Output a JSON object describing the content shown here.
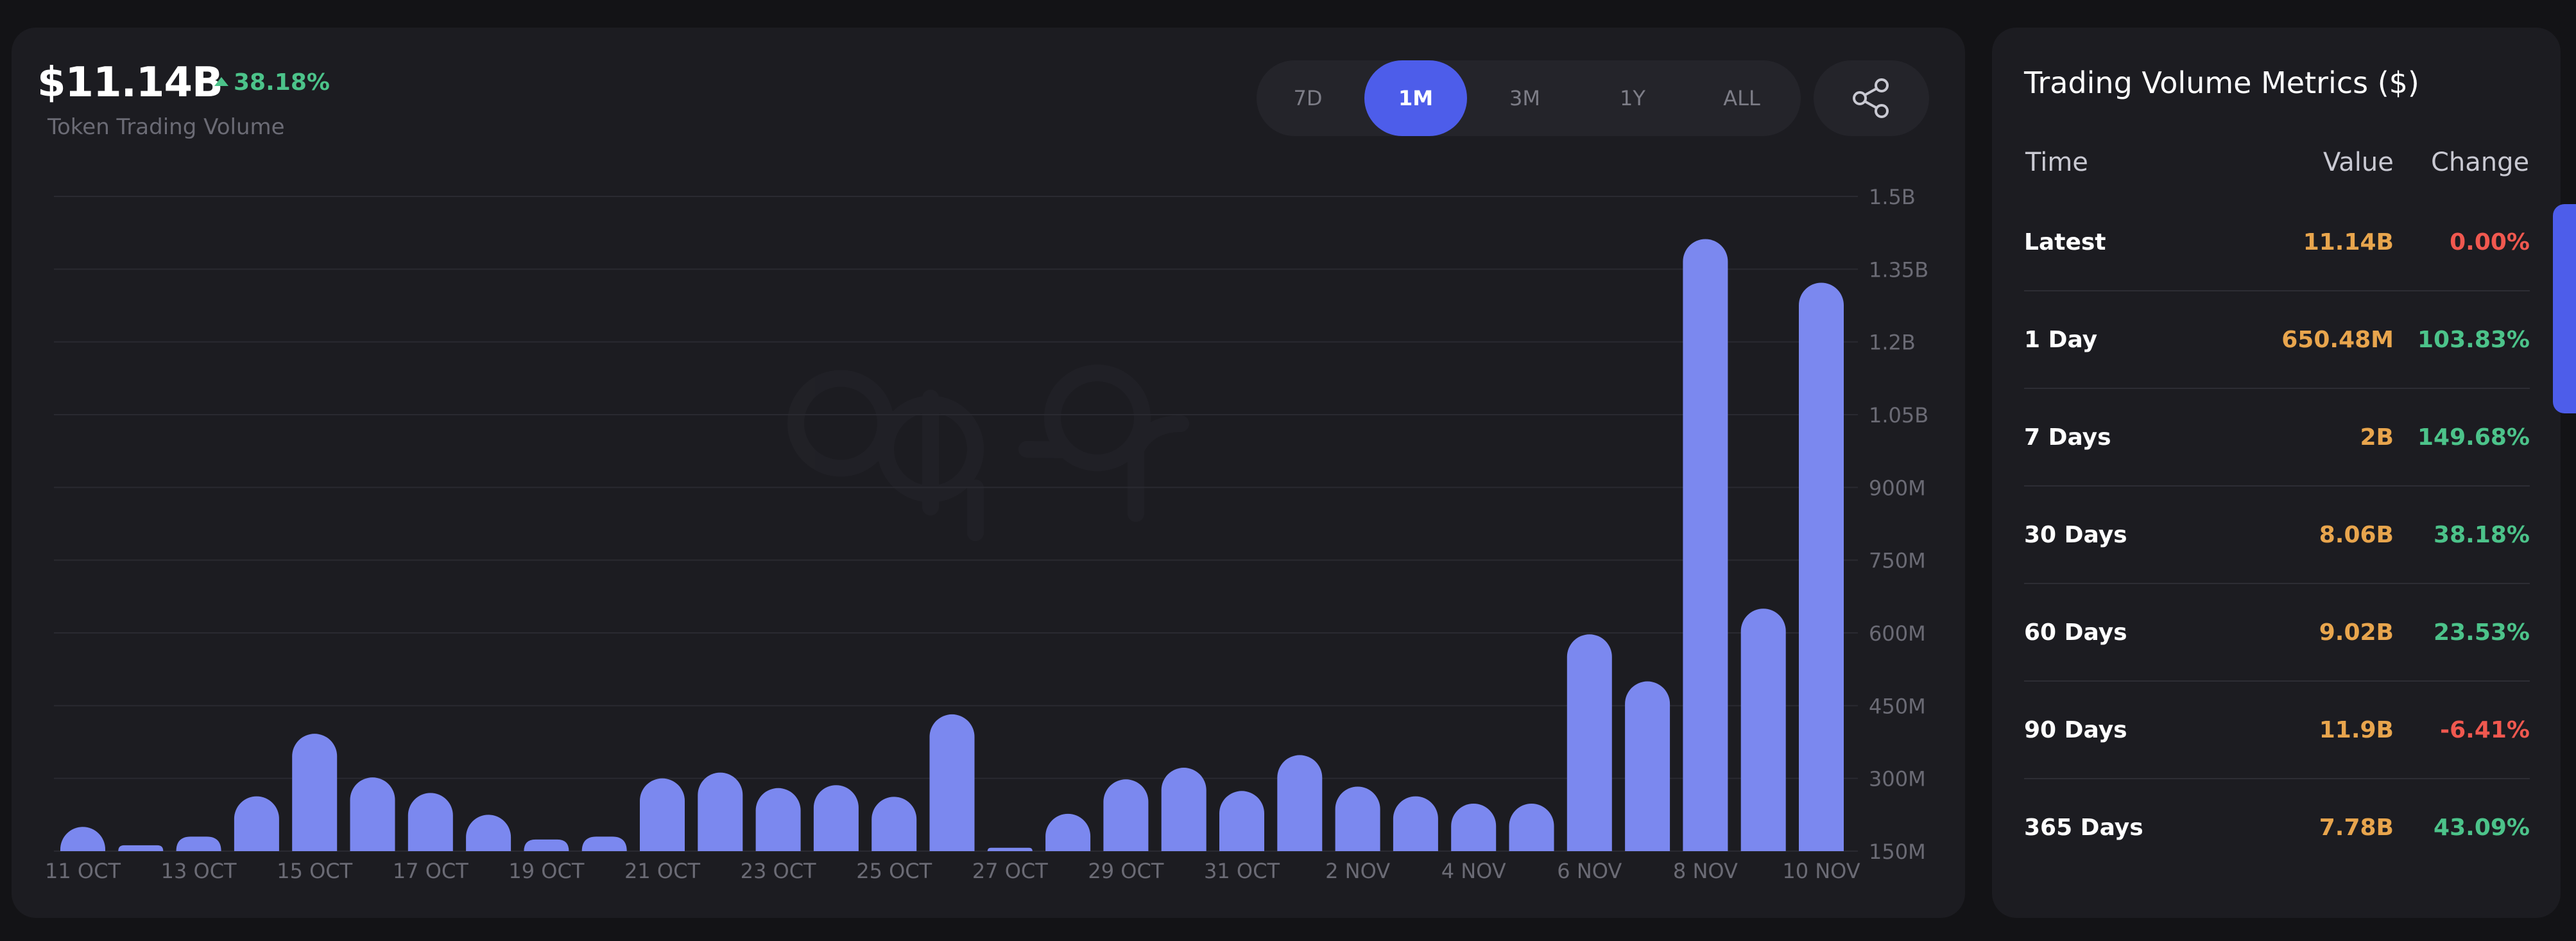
{
  "header": {
    "value": "$11.14B",
    "change": "38.18%",
    "subtitle": "Token Trading Volume"
  },
  "range_tabs": [
    "7D",
    "1M",
    "3M",
    "1Y",
    "ALL"
  ],
  "active_range": "1M",
  "colors": {
    "bar": "#7b88ef",
    "accent": "#4d5dea",
    "positive": "#4cc38a",
    "negative": "#f0584f",
    "value": "#e8a54d"
  },
  "metrics": {
    "title": "Trading Volume Metrics ($)",
    "columns": [
      "Time",
      "Value",
      "Change"
    ],
    "rows": [
      {
        "time": "Latest",
        "value": "11.14B",
        "change": "0.00%",
        "trend": "negative"
      },
      {
        "time": "1 Day",
        "value": "650.48M",
        "change": "103.83%",
        "trend": "positive"
      },
      {
        "time": "7 Days",
        "value": "2B",
        "change": "149.68%",
        "trend": "positive"
      },
      {
        "time": "30 Days",
        "value": "8.06B",
        "change": "38.18%",
        "trend": "positive"
      },
      {
        "time": "60 Days",
        "value": "9.02B",
        "change": "23.53%",
        "trend": "positive"
      },
      {
        "time": "90 Days",
        "value": "11.9B",
        "change": "-6.41%",
        "trend": "negative"
      },
      {
        "time": "365 Days",
        "value": "7.78B",
        "change": "43.09%",
        "trend": "positive"
      }
    ]
  },
  "chart_data": {
    "type": "bar",
    "x_tick_labels": [
      "11 OCT",
      "13 OCT",
      "15 OCT",
      "17 OCT",
      "19 OCT",
      "21 OCT",
      "23 OCT",
      "25 OCT",
      "27 OCT",
      "29 OCT",
      "31 OCT",
      "2 NOV",
      "4 NOV",
      "6 NOV",
      "8 NOV",
      "10 NOV"
    ],
    "y_tick_labels": [
      "150M",
      "300M",
      "450M",
      "600M",
      "750M",
      "900M",
      "1.05B",
      "1.2B",
      "1.35B",
      "1.5B"
    ],
    "y_ticks": [
      150,
      300,
      450,
      600,
      750,
      900,
      1050,
      1200,
      1350,
      1500
    ],
    "ylim": [
      150,
      1500
    ],
    "y_unit": "M",
    "grid": true,
    "legend": "none",
    "categories": [
      "11 OCT",
      "12 OCT",
      "13 OCT",
      "14 OCT",
      "15 OCT",
      "16 OCT",
      "17 OCT",
      "18 OCT",
      "19 OCT",
      "20 OCT",
      "21 OCT",
      "22 OCT",
      "23 OCT",
      "24 OCT",
      "25 OCT",
      "26 OCT",
      "27 OCT",
      "28 OCT",
      "29 OCT",
      "30 OCT",
      "31 OCT",
      "1 NOV",
      "2 NOV",
      "3 NOV",
      "4 NOV",
      "5 NOV",
      "6 NOV",
      "7 NOV",
      "8 NOV",
      "9 NOV",
      "10 NOV"
    ],
    "values": [
      200,
      162,
      180,
      263,
      392,
      302,
      270,
      225,
      174,
      180,
      300,
      312,
      280,
      286,
      262,
      432,
      157,
      227,
      298,
      322,
      274,
      348,
      283,
      263,
      248,
      248,
      597,
      500,
      1412,
      650,
      1322
    ]
  }
}
